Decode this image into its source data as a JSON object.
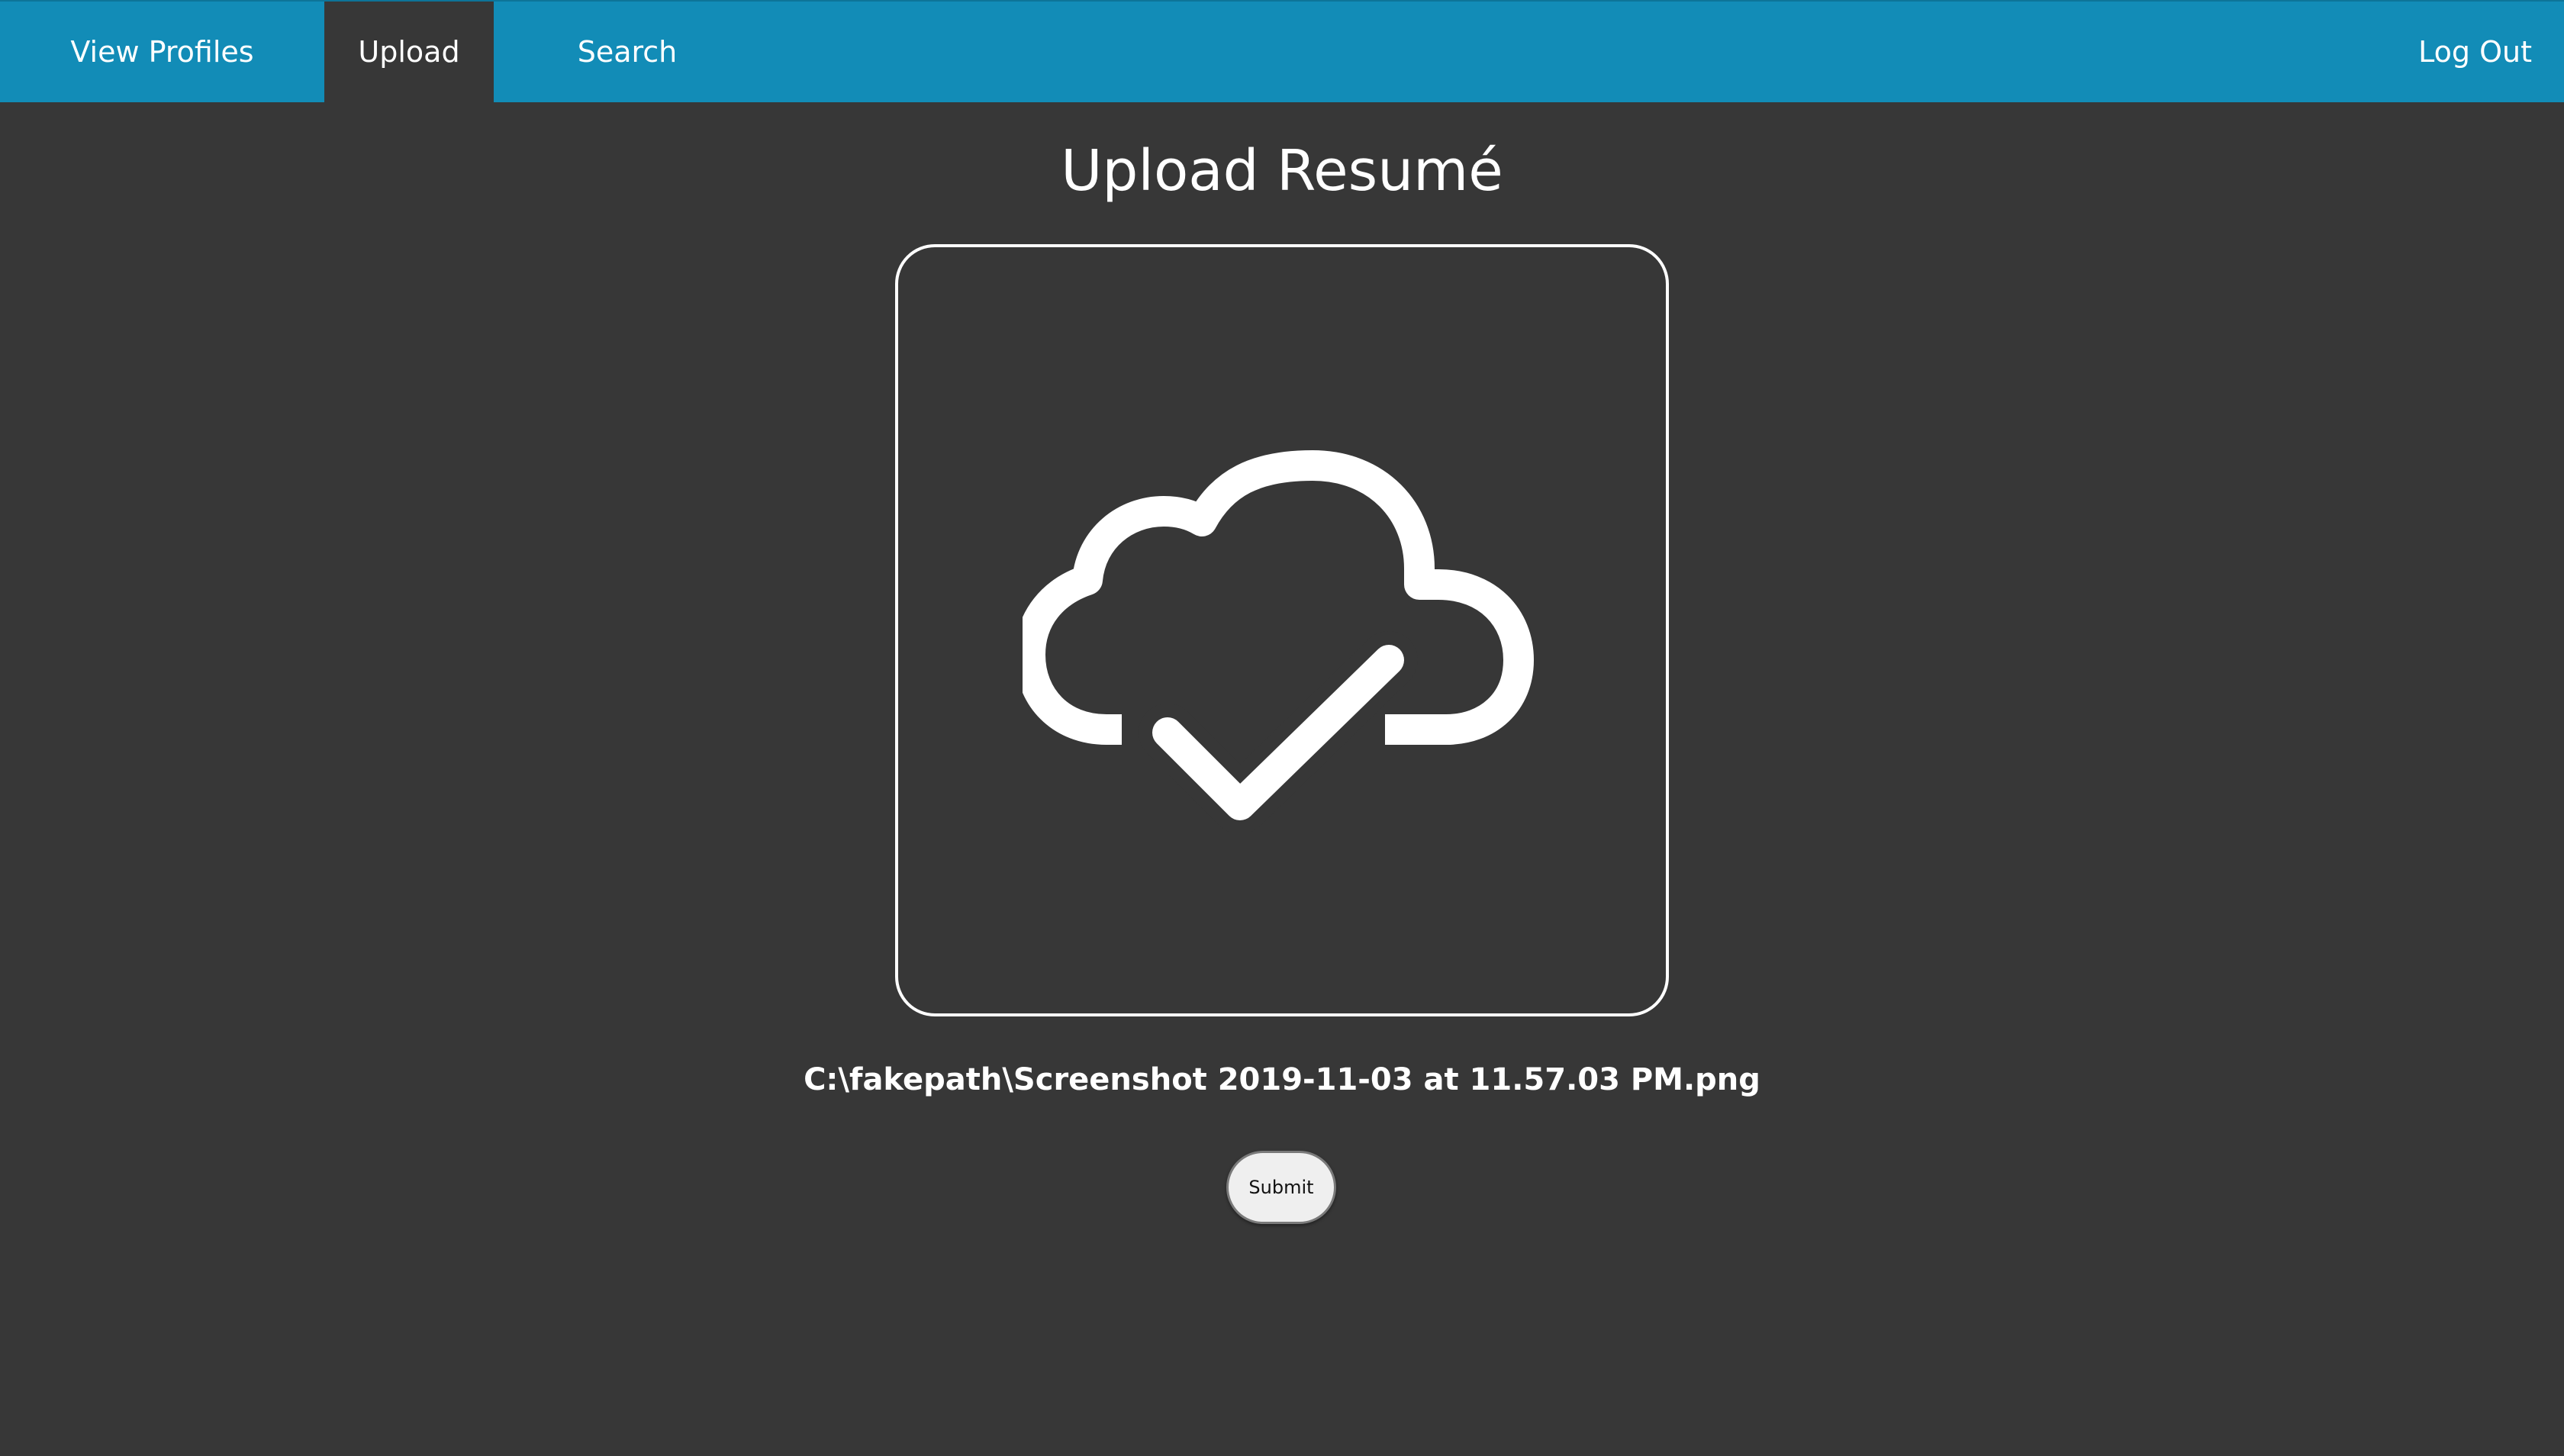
{
  "nav": {
    "view_profiles": "View Profiles",
    "upload": "Upload",
    "search": "Search",
    "log_out": "Log Out",
    "active": "Upload"
  },
  "main": {
    "title": "Upload Resumé",
    "dropzone_icon": "cloud-check-icon",
    "file_path": "C:\\fakepath\\Screenshot 2019-11-03 at 11.57.03 PM.png",
    "submit_label": "Submit"
  },
  "colors": {
    "navbar": "#128cb7",
    "background": "#373737",
    "text": "#ffffff",
    "button": "#efefef"
  }
}
